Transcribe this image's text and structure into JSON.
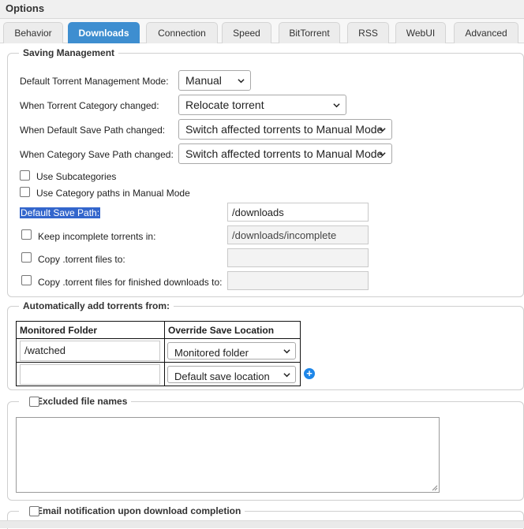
{
  "window": {
    "title": "Options"
  },
  "tabs": [
    {
      "label": "Behavior"
    },
    {
      "label": "Downloads"
    },
    {
      "label": "Connection"
    },
    {
      "label": "Speed"
    },
    {
      "label": "BitTorrent"
    },
    {
      "label": "RSS"
    },
    {
      "label": "WebUI"
    },
    {
      "label": "Advanced"
    }
  ],
  "active_tab": "Downloads",
  "saving": {
    "legend": "Saving Management",
    "mode_label": "Default Torrent Management Mode:",
    "mode_value": "Manual",
    "category_changed_label": "When Torrent Category changed:",
    "category_changed_value": "Relocate torrent",
    "default_path_changed_label": "When Default Save Path changed:",
    "default_path_changed_value": "Switch affected torrents to Manual Mode",
    "category_path_changed_label": "When Category Save Path changed:",
    "category_path_changed_value": "Switch affected torrents to Manual Mode",
    "use_subcategories_label": "Use Subcategories",
    "use_category_paths_label": "Use Category paths in Manual Mode",
    "default_save_path_label": "Default Save Path:",
    "default_save_path_value": "/downloads",
    "keep_incomplete_label": "Keep incomplete torrents in:",
    "keep_incomplete_value": "/downloads/incomplete",
    "copy_torrent_label": "Copy .torrent files to:",
    "copy_torrent_value": "",
    "copy_finished_label": "Copy .torrent files for finished downloads to:",
    "copy_finished_value": ""
  },
  "auto_add": {
    "legend": "Automatically add torrents from:",
    "col_folder": "Monitored Folder",
    "col_override": "Override Save Location",
    "rows": [
      {
        "folder": "/watched",
        "location": "Monitored folder"
      },
      {
        "folder": "",
        "location": "Default save location"
      }
    ]
  },
  "excluded": {
    "legend": "Excluded file names",
    "value": ""
  },
  "email": {
    "legend": "Email notification upon download completion"
  },
  "colors": {
    "accent": "#3e8ed0",
    "highlight": "#3366cc",
    "add_button": "#1e86e8"
  }
}
